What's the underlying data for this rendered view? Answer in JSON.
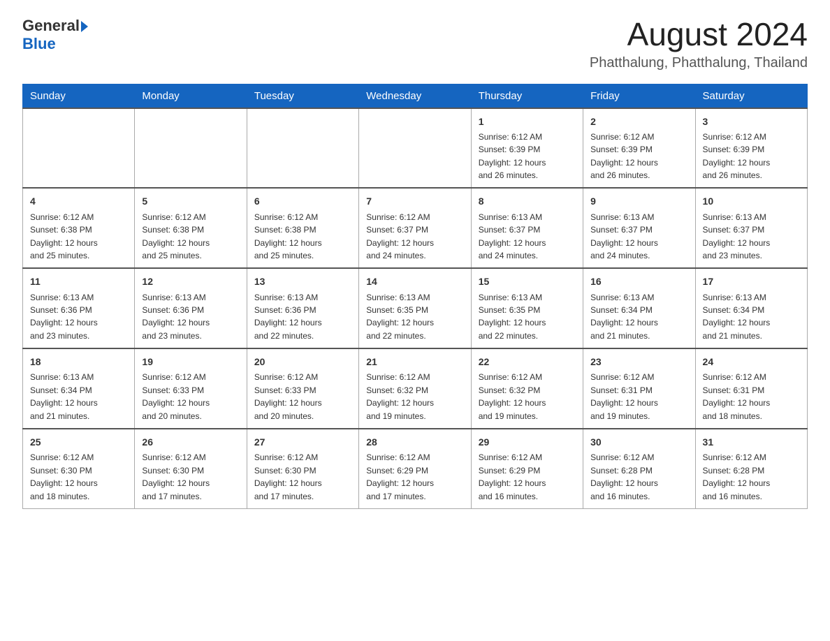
{
  "header": {
    "logo_general": "General",
    "logo_blue": "Blue",
    "month_year": "August 2024",
    "location": "Phatthalung, Phatthalung, Thailand"
  },
  "weekdays": [
    "Sunday",
    "Monday",
    "Tuesday",
    "Wednesday",
    "Thursday",
    "Friday",
    "Saturday"
  ],
  "weeks": [
    [
      {
        "day": "",
        "info": ""
      },
      {
        "day": "",
        "info": ""
      },
      {
        "day": "",
        "info": ""
      },
      {
        "day": "",
        "info": ""
      },
      {
        "day": "1",
        "info": "Sunrise: 6:12 AM\nSunset: 6:39 PM\nDaylight: 12 hours\nand 26 minutes."
      },
      {
        "day": "2",
        "info": "Sunrise: 6:12 AM\nSunset: 6:39 PM\nDaylight: 12 hours\nand 26 minutes."
      },
      {
        "day": "3",
        "info": "Sunrise: 6:12 AM\nSunset: 6:39 PM\nDaylight: 12 hours\nand 26 minutes."
      }
    ],
    [
      {
        "day": "4",
        "info": "Sunrise: 6:12 AM\nSunset: 6:38 PM\nDaylight: 12 hours\nand 25 minutes."
      },
      {
        "day": "5",
        "info": "Sunrise: 6:12 AM\nSunset: 6:38 PM\nDaylight: 12 hours\nand 25 minutes."
      },
      {
        "day": "6",
        "info": "Sunrise: 6:12 AM\nSunset: 6:38 PM\nDaylight: 12 hours\nand 25 minutes."
      },
      {
        "day": "7",
        "info": "Sunrise: 6:12 AM\nSunset: 6:37 PM\nDaylight: 12 hours\nand 24 minutes."
      },
      {
        "day": "8",
        "info": "Sunrise: 6:13 AM\nSunset: 6:37 PM\nDaylight: 12 hours\nand 24 minutes."
      },
      {
        "day": "9",
        "info": "Sunrise: 6:13 AM\nSunset: 6:37 PM\nDaylight: 12 hours\nand 24 minutes."
      },
      {
        "day": "10",
        "info": "Sunrise: 6:13 AM\nSunset: 6:37 PM\nDaylight: 12 hours\nand 23 minutes."
      }
    ],
    [
      {
        "day": "11",
        "info": "Sunrise: 6:13 AM\nSunset: 6:36 PM\nDaylight: 12 hours\nand 23 minutes."
      },
      {
        "day": "12",
        "info": "Sunrise: 6:13 AM\nSunset: 6:36 PM\nDaylight: 12 hours\nand 23 minutes."
      },
      {
        "day": "13",
        "info": "Sunrise: 6:13 AM\nSunset: 6:36 PM\nDaylight: 12 hours\nand 22 minutes."
      },
      {
        "day": "14",
        "info": "Sunrise: 6:13 AM\nSunset: 6:35 PM\nDaylight: 12 hours\nand 22 minutes."
      },
      {
        "day": "15",
        "info": "Sunrise: 6:13 AM\nSunset: 6:35 PM\nDaylight: 12 hours\nand 22 minutes."
      },
      {
        "day": "16",
        "info": "Sunrise: 6:13 AM\nSunset: 6:34 PM\nDaylight: 12 hours\nand 21 minutes."
      },
      {
        "day": "17",
        "info": "Sunrise: 6:13 AM\nSunset: 6:34 PM\nDaylight: 12 hours\nand 21 minutes."
      }
    ],
    [
      {
        "day": "18",
        "info": "Sunrise: 6:13 AM\nSunset: 6:34 PM\nDaylight: 12 hours\nand 21 minutes."
      },
      {
        "day": "19",
        "info": "Sunrise: 6:12 AM\nSunset: 6:33 PM\nDaylight: 12 hours\nand 20 minutes."
      },
      {
        "day": "20",
        "info": "Sunrise: 6:12 AM\nSunset: 6:33 PM\nDaylight: 12 hours\nand 20 minutes."
      },
      {
        "day": "21",
        "info": "Sunrise: 6:12 AM\nSunset: 6:32 PM\nDaylight: 12 hours\nand 19 minutes."
      },
      {
        "day": "22",
        "info": "Sunrise: 6:12 AM\nSunset: 6:32 PM\nDaylight: 12 hours\nand 19 minutes."
      },
      {
        "day": "23",
        "info": "Sunrise: 6:12 AM\nSunset: 6:31 PM\nDaylight: 12 hours\nand 19 minutes."
      },
      {
        "day": "24",
        "info": "Sunrise: 6:12 AM\nSunset: 6:31 PM\nDaylight: 12 hours\nand 18 minutes."
      }
    ],
    [
      {
        "day": "25",
        "info": "Sunrise: 6:12 AM\nSunset: 6:30 PM\nDaylight: 12 hours\nand 18 minutes."
      },
      {
        "day": "26",
        "info": "Sunrise: 6:12 AM\nSunset: 6:30 PM\nDaylight: 12 hours\nand 17 minutes."
      },
      {
        "day": "27",
        "info": "Sunrise: 6:12 AM\nSunset: 6:30 PM\nDaylight: 12 hours\nand 17 minutes."
      },
      {
        "day": "28",
        "info": "Sunrise: 6:12 AM\nSunset: 6:29 PM\nDaylight: 12 hours\nand 17 minutes."
      },
      {
        "day": "29",
        "info": "Sunrise: 6:12 AM\nSunset: 6:29 PM\nDaylight: 12 hours\nand 16 minutes."
      },
      {
        "day": "30",
        "info": "Sunrise: 6:12 AM\nSunset: 6:28 PM\nDaylight: 12 hours\nand 16 minutes."
      },
      {
        "day": "31",
        "info": "Sunrise: 6:12 AM\nSunset: 6:28 PM\nDaylight: 12 hours\nand 16 minutes."
      }
    ]
  ]
}
